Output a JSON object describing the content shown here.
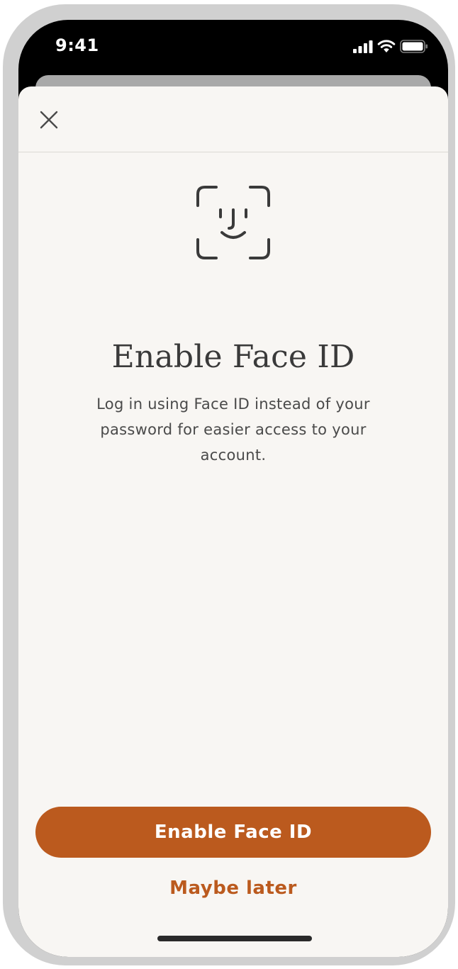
{
  "status_bar": {
    "time": "9:41",
    "icons": [
      "cellular-signal-icon",
      "wifi-icon",
      "battery-icon"
    ]
  },
  "header": {
    "close_icon": "close-icon"
  },
  "content": {
    "icon": "face-id-icon",
    "title": "Enable Face ID",
    "description": "Log in using Face ID instead of your password for easier access to your account."
  },
  "actions": {
    "primary_label": "Enable Face ID",
    "secondary_label": "Maybe later"
  },
  "colors": {
    "accent": "#bb5a1e",
    "sheet_background": "#f8f6f3",
    "text": "#3a3a3a",
    "device_frame": "#d0d0d0"
  }
}
